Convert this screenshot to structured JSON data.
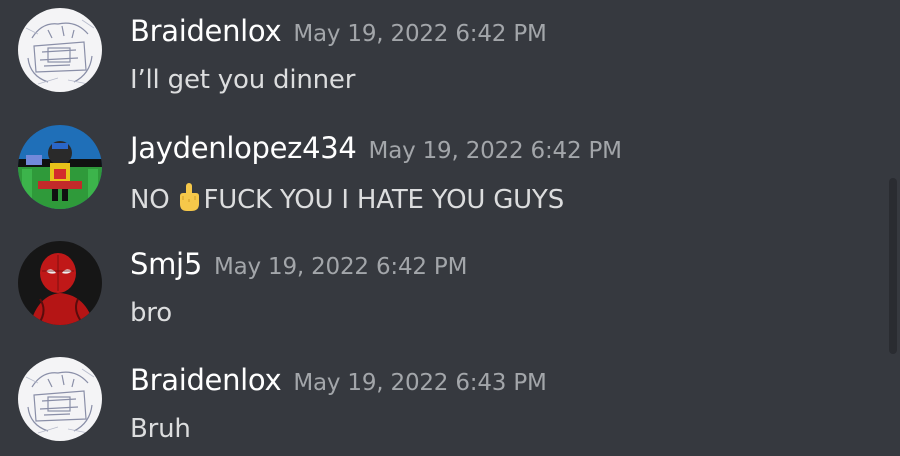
{
  "messages": [
    {
      "author": "Braidenlox",
      "timestamp": "May 19, 2022 6:42 PM",
      "text": "I’ll get you dinner",
      "avatar_icon": "sketch-avatar-icon"
    },
    {
      "author": "Jaydenlopez434",
      "timestamp": "May 19, 2022 6:42 PM",
      "text_before": "NO",
      "emoji": "middle-finger-emoji",
      "text_after": "FUCK YOU I HATE YOU GUYS",
      "avatar_icon": "pixel-character-avatar-icon"
    },
    {
      "author": "Smj5",
      "timestamp": "May 19, 2022 6:42 PM",
      "text": "bro",
      "avatar_icon": "spiderman-avatar-icon"
    },
    {
      "author": "Braidenlox",
      "timestamp": "May 19, 2022 6:43 PM",
      "text": "Bruh",
      "avatar_icon": "sketch-avatar-icon"
    }
  ],
  "colors": {
    "background": "#36393f",
    "author": "#ffffff",
    "timestamp": "#a3a6aa",
    "message_text": "#dcddde"
  }
}
